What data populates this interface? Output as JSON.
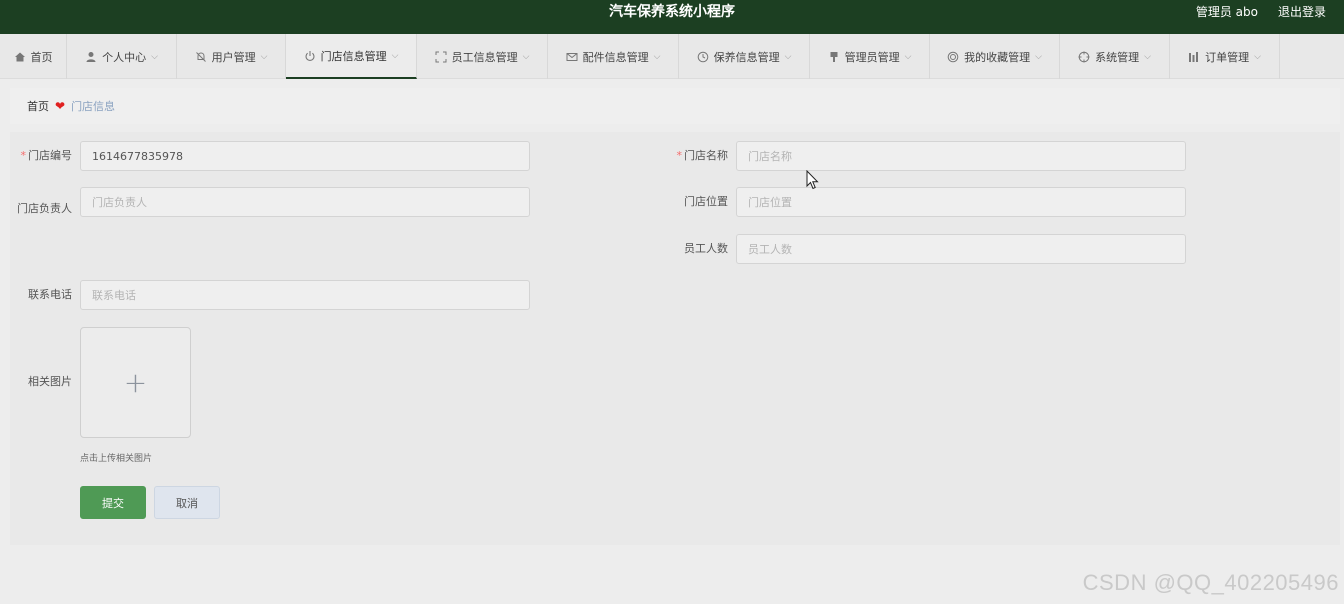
{
  "header": {
    "title": "汽车保养系统小程序",
    "user": "管理员 abo",
    "logout": "退出登录"
  },
  "nav": {
    "items": [
      {
        "label": "首页",
        "icon": "home-icon",
        "dropdown": false
      },
      {
        "label": "个人中心",
        "icon": "user-icon",
        "dropdown": true
      },
      {
        "label": "用户管理",
        "icon": "bell-off-icon",
        "dropdown": true
      },
      {
        "label": "门店信息管理",
        "icon": "power-icon",
        "dropdown": true,
        "active": true
      },
      {
        "label": "员工信息管理",
        "icon": "fullscreen-icon",
        "dropdown": true
      },
      {
        "label": "配件信息管理",
        "icon": "mail-icon",
        "dropdown": true
      },
      {
        "label": "保养信息管理",
        "icon": "clock-icon",
        "dropdown": true
      },
      {
        "label": "管理员管理",
        "icon": "brush-icon",
        "dropdown": true
      },
      {
        "label": "我的收藏管理",
        "icon": "coin-icon",
        "dropdown": true
      },
      {
        "label": "系统管理",
        "icon": "aim-icon",
        "dropdown": true
      },
      {
        "label": "订单管理",
        "icon": "bar-chart-icon",
        "dropdown": true
      }
    ]
  },
  "breadcrumb": {
    "home": "首页",
    "current": "门店信息"
  },
  "form": {
    "store_no": {
      "label": "门店编号",
      "value": "1614677835978",
      "required": true
    },
    "store_name": {
      "label": "门店名称",
      "placeholder": "门店名称",
      "required": true
    },
    "manager": {
      "label": "门店负责人",
      "placeholder": "门店负责人"
    },
    "location": {
      "label": "门店位置",
      "placeholder": "门店位置"
    },
    "staff_count": {
      "label": "员工人数",
      "placeholder": "员工人数"
    },
    "phone": {
      "label": "联系电话",
      "placeholder": "联系电话"
    },
    "image": {
      "label": "相关图片",
      "tip": "点击上传相关图片"
    },
    "submit": "提交",
    "cancel": "取消"
  },
  "watermark": "CSDN @QQ_402205496"
}
